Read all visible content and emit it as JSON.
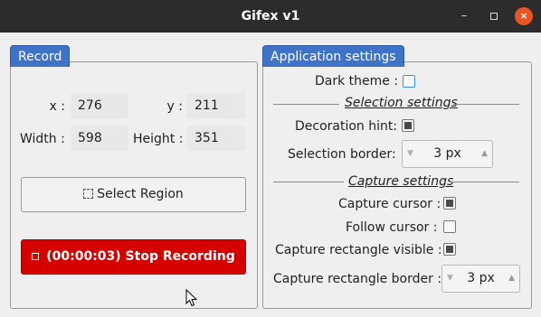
{
  "window": {
    "title": "Gifex v1",
    "min_label": "–",
    "close_label": "×"
  },
  "record": {
    "tab_label": "Record",
    "x_label": "x :",
    "x_value": "276",
    "y_label": "y :",
    "y_value": "211",
    "width_label": "Width :",
    "width_value": "598",
    "height_label": "Height :",
    "height_value": "351",
    "select_region_label": "Select Region",
    "stop_label": "(00:00:03) Stop Recording"
  },
  "settings": {
    "tab_label": "Application settings",
    "dark_theme_label": "Dark theme :",
    "dark_theme_checked": false,
    "selection_section": "Selection settings",
    "decoration_hint_label": "Decoration hint:",
    "decoration_hint_checked": true,
    "selection_border_label": "Selection border:",
    "selection_border_value": "3 px",
    "capture_section": "Capture settings",
    "capture_cursor_label": "Capture cursor :",
    "capture_cursor_checked": true,
    "follow_cursor_label": "Follow cursor :",
    "follow_cursor_checked": false,
    "capture_rect_visible_label": "Capture rectangle visible :",
    "capture_rect_visible_checked": true,
    "capture_rect_border_label": "Capture rectangle border :",
    "capture_rect_border_value": "3 px"
  },
  "colors": {
    "accent": "#3f73c8",
    "stop": "#d50000",
    "titlebar": "#2c2c2c",
    "close": "#e95420"
  }
}
